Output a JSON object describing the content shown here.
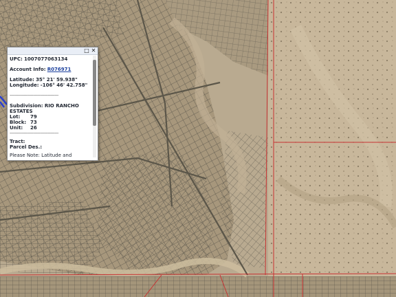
{
  "popup": {
    "upc_label": "UPC:",
    "upc_value": "1007077063134",
    "account_label": "Account Info:",
    "account_link": "R076971",
    "latitude_label": "Latitude:",
    "latitude_value": "35° 21' 59.938\"",
    "longitude_label": "Longitude:",
    "longitude_value": "-106° 46' 42.758\"",
    "separator": "-----------------------------------",
    "subdivision_label": "Subdivision:",
    "subdivision_value": "RIO RANCHO ESTATES",
    "lot_label": "Lot:",
    "lot_value": "79",
    "block_label": "Block:",
    "block_value": "73",
    "unit_label": "Unit:",
    "unit_value": "26",
    "tract_label": "Tract:",
    "parcel_label": "Parcel Des.:",
    "note": "Please Note: Latitude and Longitude is the approximate center of the parcel shown.",
    "minimize_icon": "minimize-icon",
    "close_icon": "close-icon"
  },
  "colors": {
    "parcel_lines": "#555248",
    "boundary_lines": "#c83232",
    "selected_parcel": "#2a3fd0",
    "terrain": "#b4a58c"
  }
}
